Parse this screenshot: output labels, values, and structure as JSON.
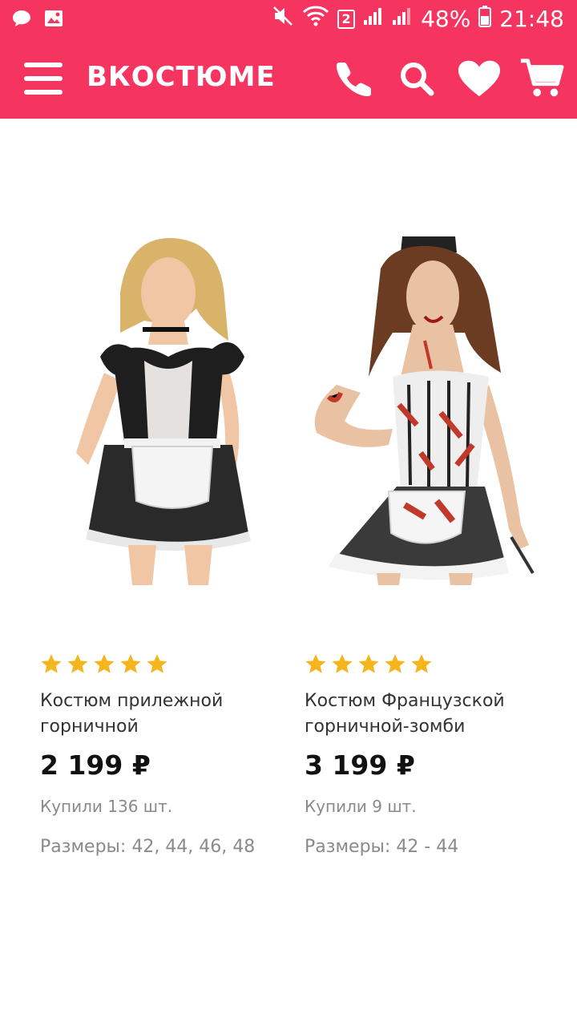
{
  "status_bar": {
    "icons_left": [
      "chat-bubble-icon",
      "image-icon"
    ],
    "sim_badge": "2",
    "battery": "48%",
    "time": "21:48"
  },
  "header": {
    "brand": "ВКОСТЮМЕ",
    "accent_color": "#f5355f",
    "icons": [
      "menu-icon",
      "phone-icon",
      "search-icon",
      "heart-icon",
      "cart-icon"
    ]
  },
  "products": [
    {
      "rating": 5,
      "name_line1": "Костюм прилежной",
      "name_line2": "горничной",
      "price": "2 199 ₽",
      "bought": "Купили 136 шт.",
      "sizes": "Размеры: 42, 44, 46, 48"
    },
    {
      "rating": 5,
      "name_line1": "Костюм Французской",
      "name_line2": "горничной-зомби",
      "price": "3 199 ₽",
      "bought": "Купили 9 шт.",
      "sizes": "Размеры: 42 - 44"
    }
  ]
}
